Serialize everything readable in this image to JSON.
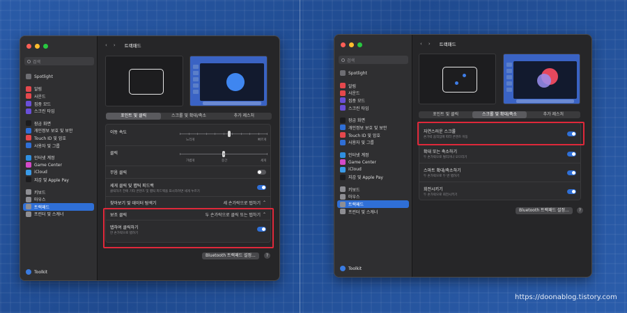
{
  "left_window": {
    "search_placeholder": "검색",
    "nav": {
      "title": "트랙패드"
    },
    "sidebar": {
      "items": [
        {
          "label": "Spotlight",
          "color": "#6e6e73"
        },
        {
          "label": "알림",
          "color": "#e5484d"
        },
        {
          "label": "사운드",
          "color": "#e5484d"
        },
        {
          "label": "집중 모드",
          "color": "#6a4fd8"
        },
        {
          "label": "스크린 타임",
          "color": "#6a4fd8"
        },
        {
          "label": "잠금 화면",
          "color": "#1c1c1e"
        },
        {
          "label": "개인정보 보호 및 보안",
          "color": "#2f6fd6"
        },
        {
          "label": "Touch ID 및 암호",
          "color": "#e5484d"
        },
        {
          "label": "사용자 및 그룹",
          "color": "#2f6fd6"
        },
        {
          "label": "인터넷 계정",
          "color": "#2f8fe0"
        },
        {
          "label": "Game Center",
          "color": "#d44ac8"
        },
        {
          "label": "iCloud",
          "color": "#3a9be8"
        },
        {
          "label": "지갑 및 Apple Pay",
          "color": "#1c1c1e"
        },
        {
          "label": "키보드",
          "color": "#8e8e93"
        },
        {
          "label": "마우스",
          "color": "#8e8e93"
        },
        {
          "label": "트랙패드",
          "color": "#8e8e93"
        },
        {
          "label": "프린터 및 스캐너",
          "color": "#8e8e93"
        }
      ],
      "selected": "트랙패드",
      "footer": "Toolkit"
    },
    "tabs": [
      "포인트 및 클릭",
      "스크롤 및 확대/축소",
      "추가 제스처"
    ],
    "active_tab": "포인트 및 클릭",
    "speed": {
      "label": "이동 속도",
      "min": "느리게",
      "max": "빠르게",
      "value": 0.56
    },
    "click": {
      "label": "클릭",
      "min": "가볍게",
      "mid": "중간",
      "max": "세게",
      "value": 0.5
    },
    "silent_click": {
      "label": "무음 클릭",
      "on": false
    },
    "force_click": {
      "label": "세게 클릭 및 햅틱 피드백",
      "sub": "클릭하기 전에 기타 콘텐츠 및 햅틱 피드백을 표시하려면 세게 누르기",
      "on": true
    },
    "lookup": {
      "label": "찾아보기 및 데이터 탐색기",
      "value": "세 손가락으로 탭하기"
    },
    "secondary": {
      "label": "보조 클릭",
      "value": "두 손가락으로 클릭 또는 탭하기"
    },
    "tap_click": {
      "label": "탭하여 클릭하기",
      "sub": "한 손가락으로 탭하기",
      "on": true
    },
    "bluetooth_button": "Bluetooth 트랙패드 설정...",
    "help": "?"
  },
  "right_window": {
    "search_placeholder": "검색",
    "nav": {
      "title": "트랙패드"
    },
    "sidebar": {
      "items": [
        {
          "label": "Spotlight",
          "color": "#6e6e73"
        },
        {
          "label": "알림",
          "color": "#e5484d"
        },
        {
          "label": "사운드",
          "color": "#e5484d"
        },
        {
          "label": "집중 모드",
          "color": "#6a4fd8"
        },
        {
          "label": "스크린 타임",
          "color": "#6a4fd8"
        },
        {
          "label": "잠금 화면",
          "color": "#1c1c1e"
        },
        {
          "label": "개인정보 보호 및 보안",
          "color": "#2f6fd6"
        },
        {
          "label": "Touch ID 및 암호",
          "color": "#e5484d"
        },
        {
          "label": "사용자 및 그룹",
          "color": "#2f6fd6"
        },
        {
          "label": "인터넷 계정",
          "color": "#2f8fe0"
        },
        {
          "label": "Game Center",
          "color": "#d44ac8"
        },
        {
          "label": "iCloud",
          "color": "#3a9be8"
        },
        {
          "label": "지갑 및 Apple Pay",
          "color": "#1c1c1e"
        },
        {
          "label": "키보드",
          "color": "#8e8e93"
        },
        {
          "label": "마우스",
          "color": "#8e8e93"
        },
        {
          "label": "트랙패드",
          "color": "#8e8e93"
        },
        {
          "label": "프린터 및 스캐너",
          "color": "#8e8e93"
        }
      ],
      "selected": "트랙패드",
      "footer": "Toolkit"
    },
    "tabs": [
      "포인트 및 클릭",
      "스크롤 및 확대/축소",
      "추가 제스처"
    ],
    "active_tab": "스크롤 및 확대/축소",
    "natural_scroll": {
      "label": "자연스러운 스크롤",
      "sub": "손가락 움직임에 따라 콘텐츠 이동",
      "on": true
    },
    "zoom": {
      "label": "확대 또는 축소하기",
      "sub": "두 손가락으로 벌리거나 오므리기",
      "on": true
    },
    "smart_zoom": {
      "label": "스마트 확대/축소하기",
      "sub": "두 손가락으로 두 번 탭하기",
      "on": true
    },
    "rotate": {
      "label": "회전시키기",
      "sub": "두 손가락으로 회전시키기",
      "on": true
    },
    "bluetooth_button": "Bluetooth 트랙패드 설정...",
    "help": "?"
  },
  "credit": "https://doonablog.tistory.com"
}
